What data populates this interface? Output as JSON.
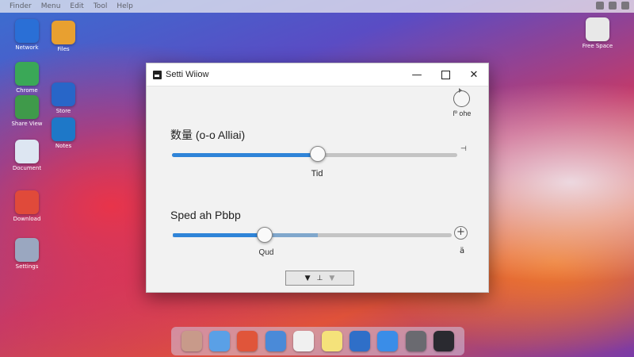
{
  "desktop": {
    "menubar": [
      "Finder",
      "Menu",
      "Edit",
      "Tool",
      "Help"
    ],
    "left_icons": [
      {
        "label": "Network",
        "color": "#2a6fd6",
        "icon": "globe-icon"
      },
      {
        "label": "Files",
        "color": "#e8a030",
        "icon": "folder-icon"
      },
      {
        "label": "Chrome",
        "color": "#3aa857",
        "icon": "chrome-icon"
      },
      {
        "label": "Store",
        "color": "#2866c8",
        "icon": "store-icon"
      },
      {
        "label": "Share View",
        "color": "#3f9a4a",
        "icon": "screen-icon"
      },
      {
        "label": "Notes",
        "color": "#1e78c8",
        "icon": "notes-icon"
      },
      {
        "label": "Document",
        "color": "#dde6f2",
        "icon": "document-icon"
      },
      {
        "label": "Download",
        "color": "#e04a3a",
        "icon": "download-icon"
      },
      {
        "label": "Settings",
        "color": "#9aa7c0",
        "icon": "settings-icon"
      }
    ],
    "right_icon": {
      "label": "Free Space",
      "color": "#e8e8e8",
      "icon": "drive-icon"
    },
    "dock_icons": [
      {
        "name": "photos-icon",
        "color": "#c89a8a"
      },
      {
        "name": "finder-icon",
        "color": "#5aa0e6"
      },
      {
        "name": "chrome-icon",
        "color": "#e0553a"
      },
      {
        "name": "preview-icon",
        "color": "#4a8ad8"
      },
      {
        "name": "pages-icon",
        "color": "#f0f0f0"
      },
      {
        "name": "notes-icon",
        "color": "#f5e27a"
      },
      {
        "name": "mail-icon",
        "color": "#2f6fc8"
      },
      {
        "name": "appstore-icon",
        "color": "#3a8de8"
      },
      {
        "name": "settings-icon",
        "color": "#6a6a70"
      },
      {
        "name": "terminal-icon",
        "color": "#2a2a30"
      }
    ]
  },
  "window": {
    "title": "Setti Wiiow",
    "minimize": "—",
    "close": "✕"
  },
  "refresh": {
    "label": "ſº ohe"
  },
  "quantity": {
    "label": "数量 (o-o Alliai)",
    "value_label": "Tid",
    "end_label": "⊣",
    "value_fraction": 0.51
  },
  "speed": {
    "label": "Sped ah Pbbp",
    "value_label": "Qud",
    "end_label": "ä",
    "plus": "+",
    "value_fraction": 0.33,
    "extra_fill_fraction": 0.52
  },
  "actions": {
    "down": "▼",
    "center": "⊥",
    "disabled": "▼"
  }
}
